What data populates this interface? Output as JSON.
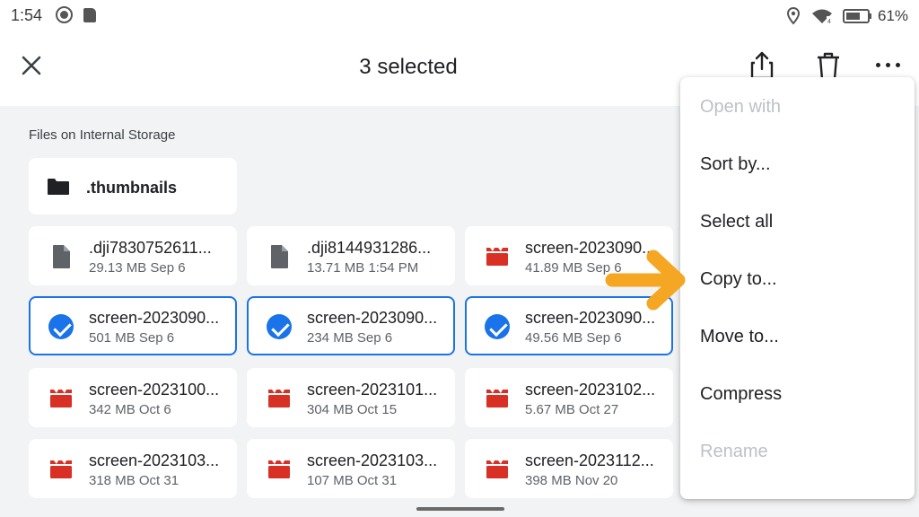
{
  "status_bar": {
    "time": "1:54",
    "battery_percent": "61%",
    "icons": [
      "screen-record-icon",
      "sd-card-icon",
      "location-icon",
      "wifi-icon",
      "battery-icon"
    ]
  },
  "app_bar": {
    "title": "3 selected",
    "actions": [
      "close-icon",
      "share-icon",
      "trash-icon",
      "more-icon"
    ]
  },
  "section_title": "Files on Internal Storage",
  "folder": {
    "name": ".thumbnails",
    "icon": "folder-icon"
  },
  "files": [
    [
      {
        "name": ".dji7830752611...",
        "meta": "29.13 MB Sep 6",
        "icon": "document-icon",
        "selected": false
      },
      {
        "name": ".dji8144931286...",
        "meta": "13.71 MB 1:54 PM",
        "icon": "document-icon",
        "selected": false
      },
      {
        "name": "screen-2023090...",
        "meta": "41.89 MB Sep 6",
        "icon": "video-icon",
        "selected": false
      }
    ],
    [
      {
        "name": "screen-2023090...",
        "meta": "501 MB Sep 6",
        "icon": "check-icon",
        "selected": true
      },
      {
        "name": "screen-2023090...",
        "meta": "234 MB Sep 6",
        "icon": "check-icon",
        "selected": true
      },
      {
        "name": "screen-2023090...",
        "meta": "49.56 MB Sep 6",
        "icon": "check-icon",
        "selected": true
      }
    ],
    [
      {
        "name": "screen-2023100...",
        "meta": "342 MB Oct 6",
        "icon": "video-icon",
        "selected": false
      },
      {
        "name": "screen-2023101...",
        "meta": "304 MB Oct 15",
        "icon": "video-icon",
        "selected": false
      },
      {
        "name": "screen-2023102...",
        "meta": "5.67 MB Oct 27",
        "icon": "video-icon",
        "selected": false
      }
    ],
    [
      {
        "name": "screen-2023103...",
        "meta": "318 MB Oct 31",
        "icon": "video-icon",
        "selected": false
      },
      {
        "name": "screen-2023103...",
        "meta": "107 MB Oct 31",
        "icon": "video-icon",
        "selected": false
      },
      {
        "name": "screen-2023112...",
        "meta": "398 MB Nov 20",
        "icon": "video-icon",
        "selected": false
      }
    ]
  ],
  "menu": {
    "items": [
      {
        "label": "Open with",
        "enabled": false
      },
      {
        "label": "Sort by...",
        "enabled": true
      },
      {
        "label": "Select all",
        "enabled": true
      },
      {
        "label": "Copy to...",
        "enabled": true
      },
      {
        "label": "Move to...",
        "enabled": true
      },
      {
        "label": "Compress",
        "enabled": true
      },
      {
        "label": "Rename",
        "enabled": false
      }
    ]
  },
  "colors": {
    "accent": "#1a73e8",
    "video_icon": "#d93025",
    "annotation_arrow": "#f5a623",
    "background": "#f1f3f5"
  }
}
